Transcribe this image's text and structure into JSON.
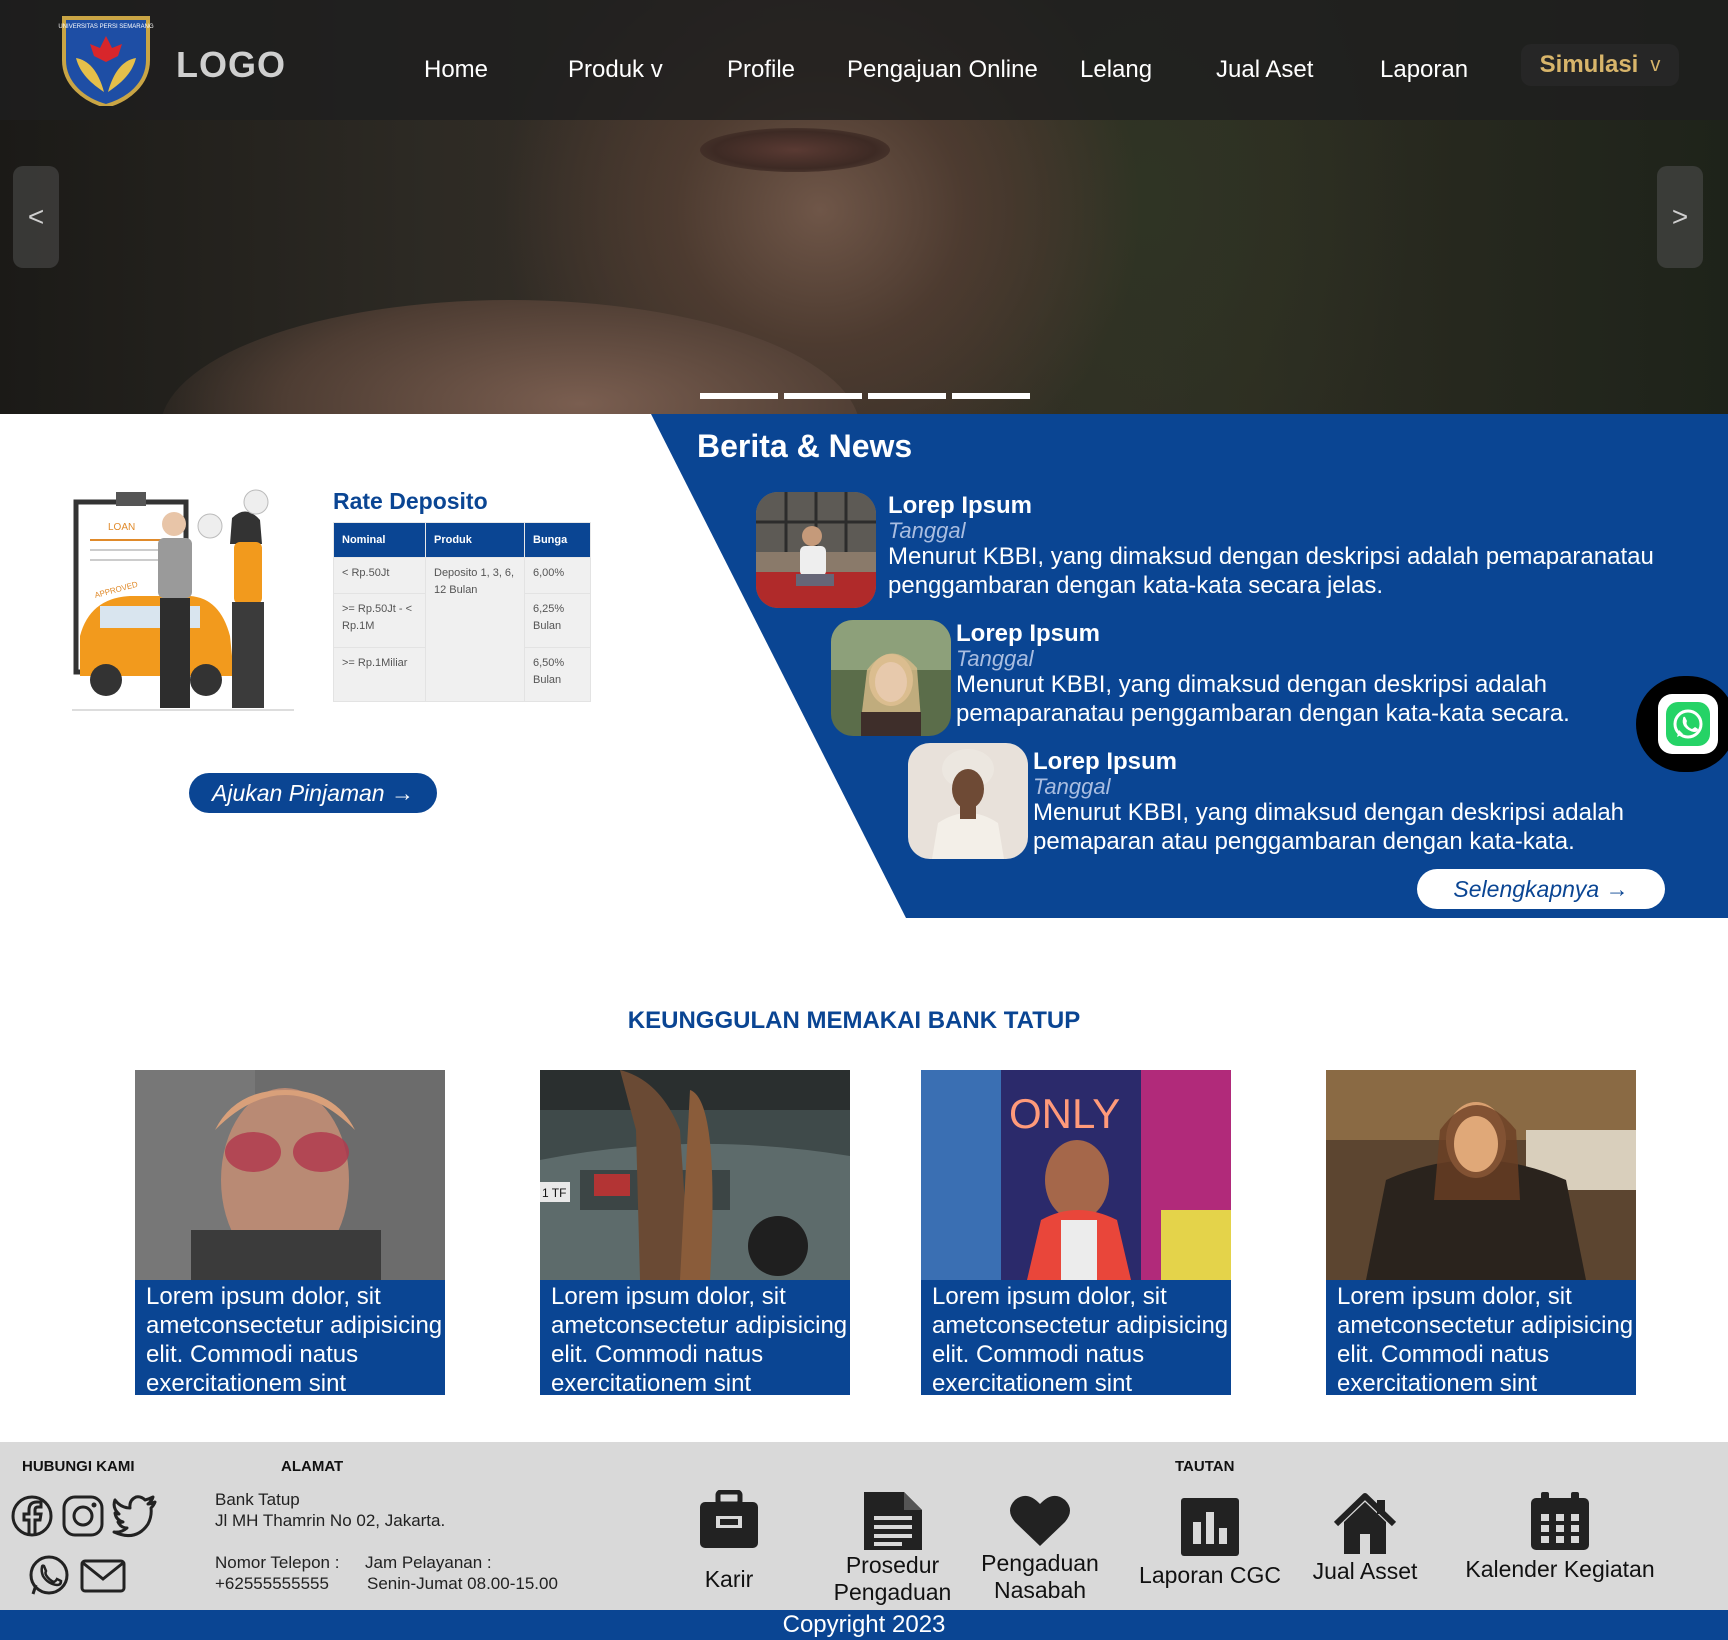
{
  "header": {
    "logo_text": "LOGO",
    "emblem_text": "UNIVERSITAS PERSI SEMARANG",
    "nav": [
      "Home",
      "Produk v",
      "Profile",
      "Pengajuan Online",
      "Lelang",
      "Jual Aset",
      "Laporan"
    ],
    "simulasi_label": "Simulasi",
    "simulasi_chevron": "v"
  },
  "hero": {
    "prev": "<",
    "next": ">",
    "slides": 4
  },
  "rate": {
    "title": "Rate Deposito",
    "illustration_labels": {
      "loan": "LOAN",
      "approved": "APPROVED"
    },
    "headers": [
      "Nominal",
      "Produk",
      "Bunga"
    ],
    "rows": [
      {
        "nominal": "< Rp.50Jt",
        "bunga": "6,00%"
      },
      {
        "nominal": ">= Rp.50Jt - < Rp.1M",
        "bunga": "6,25% Bulan"
      },
      {
        "nominal": ">= Rp.1Miliar",
        "bunga": "6,50% Bulan"
      }
    ],
    "produk": "Deposito 1, 3, 6, 12 Bulan",
    "button": "Ajukan Pinjaman →"
  },
  "news": {
    "title": "Berita & News",
    "items": [
      {
        "heading": "Lorep Ipsum",
        "date": "Tanggal",
        "text": "Menurut KBBI, yang dimaksud dengan deskripsi adalah pemaparanatau penggambaran dengan kata-kata secara jelas."
      },
      {
        "heading": "Lorep Ipsum",
        "date": "Tanggal",
        "text": "Menurut KBBI, yang dimaksud dengan deskripsi adalah pemaparanatau penggambaran dengan kata-kata secara."
      },
      {
        "heading": "Lorep Ipsum",
        "date": "Tanggal",
        "text": "Menurut KBBI, yang dimaksud dengan deskripsi adalah pemaparan atau penggambaran dengan kata-kata."
      }
    ],
    "more_button": "Selengkapnya →"
  },
  "advantages": {
    "title": "KEUNGGULAN MEMAKAI BANK TATUP",
    "cards": [
      {
        "caption": "Lorem ipsum dolor, sit ametconsectetur adipisicing elit. Commodi natus exercitationem sint"
      },
      {
        "caption": "Lorem ipsum dolor, sit ametconsectetur adipisicing elit. Commodi natus exercitationem sint",
        "plate": "1 TF"
      },
      {
        "caption": "Lorem ipsum dolor, sit ametconsectetur adipisicing elit. Commodi natus exercitationem sint",
        "neon": "ONLY"
      },
      {
        "caption": "Lorem ipsum dolor, sit ametconsectetur adipisicing elit. Commodi natus exercitationem sint"
      }
    ]
  },
  "footer": {
    "hubungi_title": "HUBUNGI KAMI",
    "alamat_title": "ALAMAT",
    "tautan_title": "TAUTAN",
    "alamat_name": "Bank Tatup",
    "alamat_street": "Jl MH Thamrin No 02, Jakarta.",
    "phone_label": "Nomor Telepon :",
    "phone_value": "+62555555555",
    "hours_label": "Jam Pelayanan :",
    "hours_value": "Senin-Jumat 08.00-15.00",
    "links": [
      {
        "line1": "Karir",
        "line2": "",
        "icon": "briefcase-icon"
      },
      {
        "line1": "Prosedur",
        "line2": "Pengaduan",
        "icon": "document-icon"
      },
      {
        "line1": "Pengaduan",
        "line2": "Nasabah",
        "icon": "heart-icon"
      },
      {
        "line1": "Laporan CGC",
        "line2": "",
        "icon": "bar-chart-icon"
      },
      {
        "line1": "Jual Asset",
        "line2": "",
        "icon": "home-icon"
      },
      {
        "line1": "Kalender Kegiatan",
        "line2": "",
        "icon": "calendar-icon"
      }
    ],
    "copyright": "Copyright 2023"
  },
  "colors": {
    "primary": "#0A4593",
    "accent": "#D8B56A",
    "footer_bg": "#D9D9D9",
    "whatsapp": "#25D366"
  }
}
